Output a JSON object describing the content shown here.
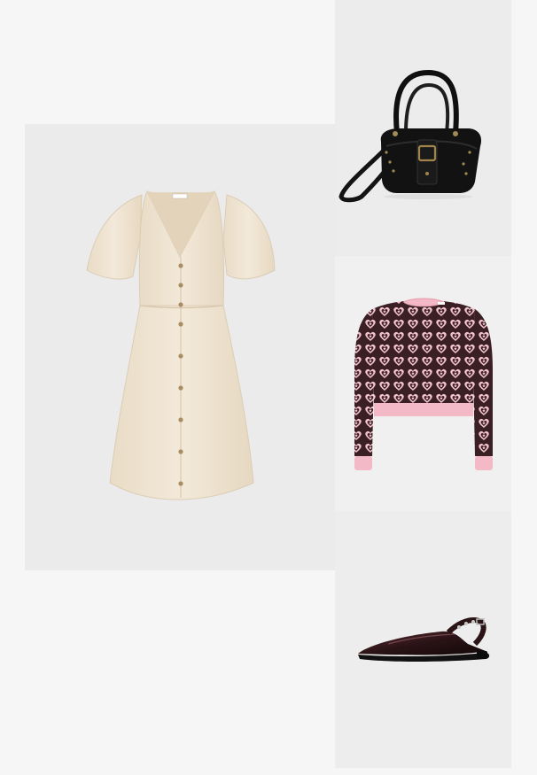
{
  "products": [
    {
      "id": "dress",
      "icon": "dress-icon",
      "color": "#efe4d2"
    },
    {
      "id": "handbag",
      "icon": "handbag-icon",
      "color": "#151515"
    },
    {
      "id": "sweater",
      "icon": "sweater-icon",
      "color": "#f2b8c6"
    },
    {
      "id": "slingback-flats",
      "icon": "shoe-icon",
      "color": "#2a1416"
    }
  ]
}
